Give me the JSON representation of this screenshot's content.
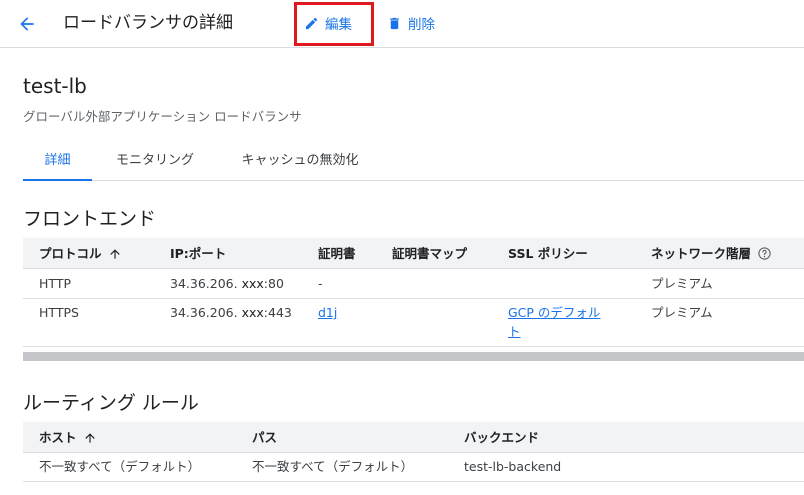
{
  "header": {
    "title": "ロードバランサの詳細",
    "edit_label": "編集",
    "delete_label": "削除",
    "accent": "#1a73e8",
    "highlight": "#e0191f"
  },
  "lb": {
    "name": "test-lb",
    "type": "グローバル外部アプリケーション ロードバランサ"
  },
  "tabs": [
    {
      "label": "詳細",
      "active": true
    },
    {
      "label": "モニタリング",
      "active": false
    },
    {
      "label": "キャッシュの無効化",
      "active": false
    }
  ],
  "frontend": {
    "title": "フロントエンド",
    "columns": [
      "プロトコル",
      "IP:ポート",
      "証明書",
      "証明書マップ",
      "SSL ポリシー",
      "ネットワーク階層"
    ],
    "rows": [
      {
        "protocol": "HTTP",
        "ip_a": "34.36.206.",
        "ip_b": "xxx",
        "ip_c": ":80",
        "cert": "-",
        "cert_map": "",
        "ssl_1": "",
        "ssl_2": "",
        "tier": "プレミアム"
      },
      {
        "protocol": "HTTPS",
        "ip_a": "34.36.206.",
        "ip_b": "xxx",
        "ip_c": ":443",
        "cert": "d1j",
        "cert_map": "",
        "ssl_1": "GCP のデフォル",
        "ssl_2": "ト",
        "tier": "プレミアム"
      }
    ]
  },
  "routing": {
    "title": "ルーティング ルール",
    "columns": [
      "ホスト",
      "パス",
      "バックエンド"
    ],
    "rows": [
      {
        "host": "不一致すべて（デフォルト）",
        "path": "不一致すべて（デフォルト）",
        "backend": "test-lb-backend"
      }
    ]
  }
}
